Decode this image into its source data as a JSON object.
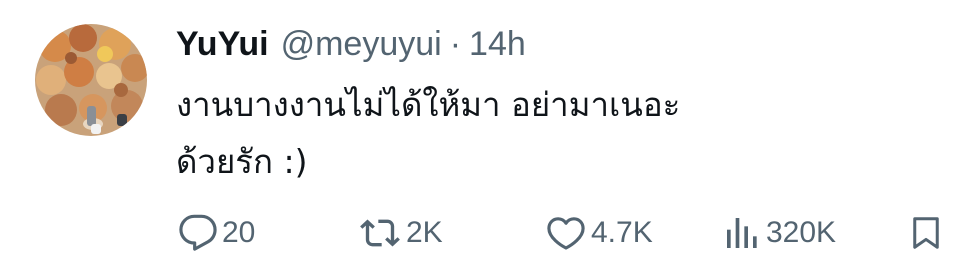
{
  "tweet": {
    "display_name": "YuYui",
    "handle": "@meyuyui",
    "separator": "·",
    "timestamp": "14h",
    "text_lines": [
      "งานบางงานไม่ได้ให้มา อย่ามาเนอะ",
      "ด้วยรัก :)"
    ]
  },
  "actions": {
    "reply": {
      "icon": "speech-bubble-icon",
      "count": "20"
    },
    "retweet": {
      "icon": "retweet-arrows-icon",
      "count": "2K"
    },
    "like": {
      "icon": "heart-icon",
      "count": "4.7K"
    },
    "views": {
      "icon": "bar-chart-icon",
      "count": "320K"
    },
    "bookmark": {
      "icon": "bookmark-icon"
    }
  },
  "colors": {
    "text_primary": "#0f1419",
    "text_secondary": "#536471",
    "background": "#ffffff"
  }
}
